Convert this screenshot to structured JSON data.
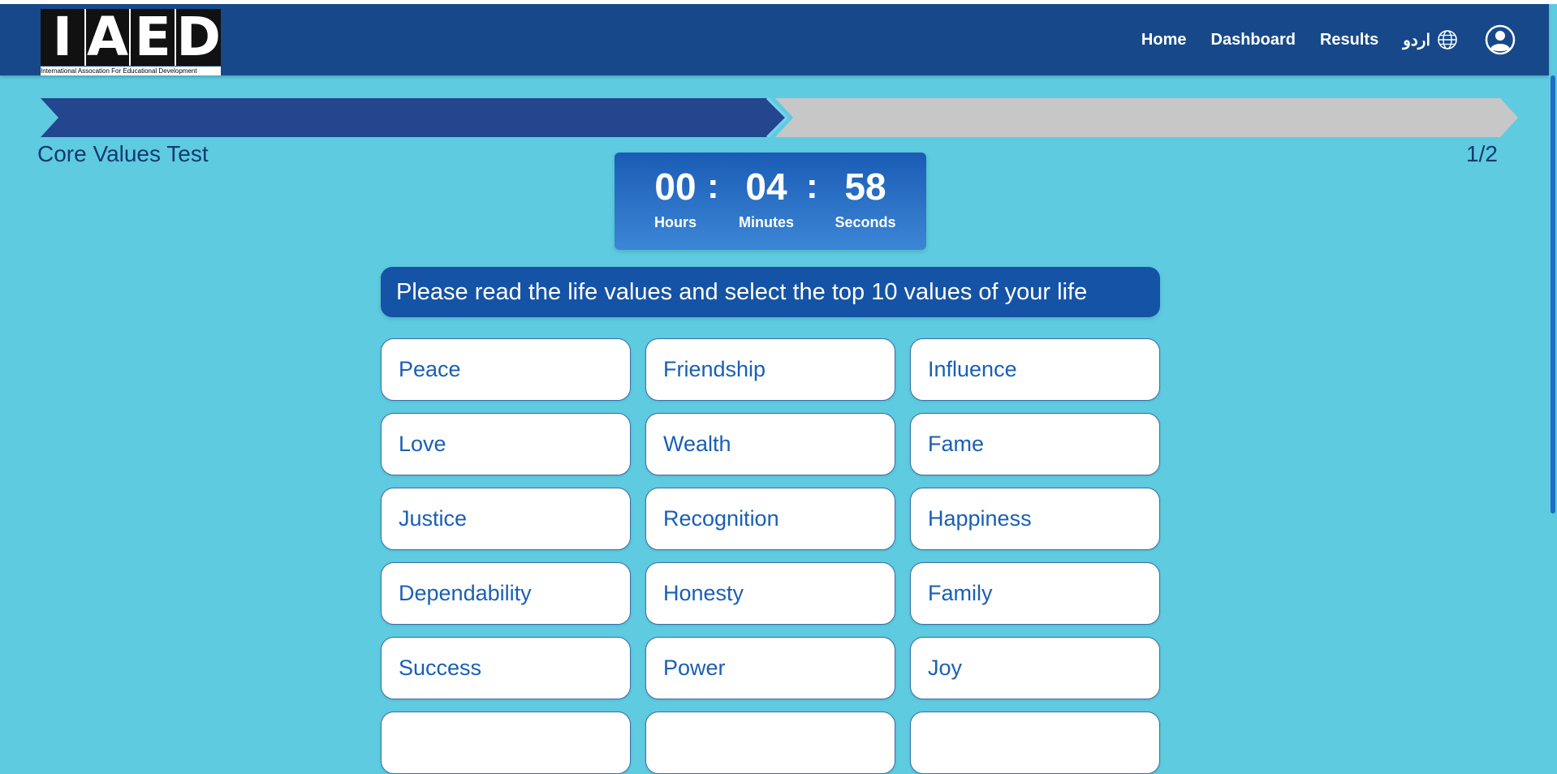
{
  "header": {
    "logo_letters": [
      "I",
      "A",
      "E",
      "D"
    ],
    "logo_tagline": "International Assocation For Educational Development",
    "nav": [
      "Home",
      "Dashboard",
      "Results"
    ],
    "language": "اردو",
    "icons": {
      "language": "globe-icon",
      "account": "user-circle-icon"
    }
  },
  "test": {
    "title": "Core Values Test",
    "step": "1/2",
    "progress_fraction": 0.5
  },
  "timer": {
    "hours": "00",
    "minutes": "04",
    "seconds": "58",
    "separator": ":",
    "hours_label": "Hours",
    "minutes_label": "Minutes",
    "seconds_label": "Seconds"
  },
  "instruction": "Please read the life values and select the top 10 values of your life",
  "values": [
    "Peace",
    "Friendship",
    "Influence",
    "Love",
    "Wealth",
    "Fame",
    "Justice",
    "Recognition",
    "Happiness",
    "Dependability",
    "Honesty",
    "Family",
    "Success",
    "Power",
    "Joy",
    "",
    "",
    ""
  ],
  "colors": {
    "background": "#5ecbe1",
    "navbar": "#17498a",
    "progress_done": "#24468f",
    "progress_remaining": "#c7c7c7",
    "card_text": "#1a5fb4"
  }
}
